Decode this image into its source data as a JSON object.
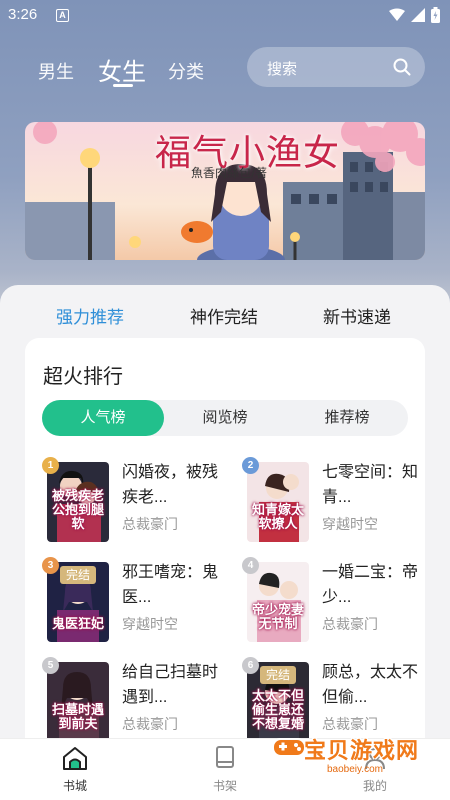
{
  "status_bar": {
    "time": "3:26",
    "notification_letter": "A"
  },
  "header": {
    "tabs": [
      {
        "label": "男生",
        "active": false
      },
      {
        "label": "女生",
        "active": true
      },
      {
        "label": "分类",
        "active": false
      }
    ],
    "search": {
      "placeholder": "搜索",
      "icon": "search-icon"
    }
  },
  "banner": {
    "title": "福气小渔女",
    "author": "魚香肉絲包/著"
  },
  "section_tabs": [
    {
      "label": "强力推荐",
      "active": true
    },
    {
      "label": "神作完结",
      "active": false
    },
    {
      "label": "新书速递",
      "active": false
    }
  ],
  "ranking": {
    "title": "超火排行",
    "tabs": [
      {
        "label": "人气榜",
        "active": true
      },
      {
        "label": "阅览榜",
        "active": false
      },
      {
        "label": "推荐榜",
        "active": false
      }
    ],
    "books": [
      {
        "rank": "1",
        "title": "闪婚夜，被残疾老...",
        "category": "总裁豪门",
        "cover_text": "被残疾老公抱到腿软"
      },
      {
        "rank": "2",
        "title": "七零空间：知青...",
        "category": "穿越时空",
        "cover_text": "知青嫁太软撩人"
      },
      {
        "rank": "3",
        "title": "邪王嗜宠：鬼医...",
        "category": "穿越时空",
        "cover_text": "鬼医狂妃",
        "finished": "完结"
      },
      {
        "rank": "4",
        "title": "一婚二宝：帝少...",
        "category": "总裁豪门",
        "cover_text": "帝少宠妻无节制"
      },
      {
        "rank": "5",
        "title": "给自己扫墓时遇到...",
        "category": "总裁豪门",
        "cover_text": "扫墓时遇到前夫"
      },
      {
        "rank": "6",
        "title": "顾总，太太不但偷...",
        "category": "总裁豪门",
        "cover_text": "太太不但偷生崽还不想复婚",
        "finished": "完结"
      }
    ]
  },
  "bottom_nav": [
    {
      "label": "书城",
      "icon": "bookstore-home-icon",
      "active": true
    },
    {
      "label": "书架",
      "icon": "bookshelf-icon",
      "active": false
    },
    {
      "label": "我的",
      "icon": "profile-icon",
      "active": false
    }
  ],
  "watermark": {
    "main": "宝贝游戏网",
    "sub": "baobeiy.com"
  },
  "colors": {
    "accent_green": "#22c08c",
    "accent_blue": "#2f8fd8",
    "banner_title": "#c8264a"
  }
}
